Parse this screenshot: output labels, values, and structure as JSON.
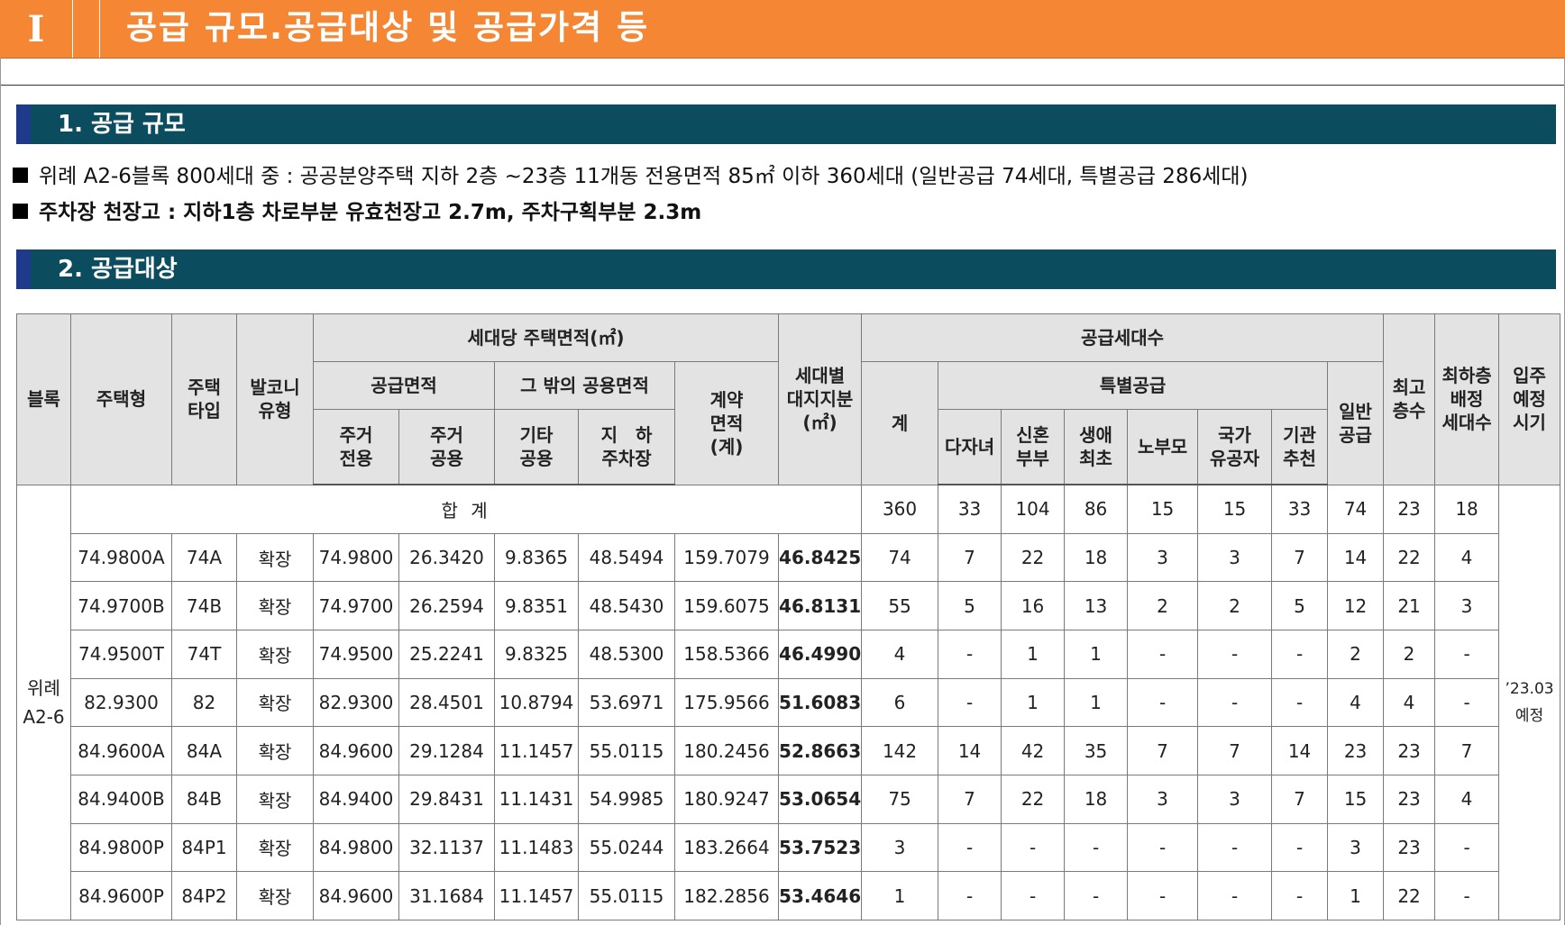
{
  "header": {
    "roman": "I",
    "title": "공급 규모.공급대상 및 공급가격 등"
  },
  "sections": {
    "s1": "1. 공급 규모",
    "s2": "2. 공급대상"
  },
  "bullets": [
    "위례 A2-6블록 800세대 중 : 공공분양주택 지하 2층 ~23층 11개동 전용면적 85㎡ 이하 360세대 (일반공급 74세대, 특별공급 286세대)",
    "주차장 천장고 : 지하1층 차로부분 유효천장고 2.7m, 주차구획부분 2.3m"
  ],
  "table": {
    "headers": {
      "block": "블록",
      "house_type": "주택형",
      "type_a": "주택",
      "type_b": "타입",
      "balcony_a": "발코니",
      "balcony_b": "유형",
      "area_per_unit": "세대당 주택면적(㎡)",
      "supply_area": "공급면적",
      "other_common": "그 밖의 공용면적",
      "res_excl_a": "주거",
      "res_excl_b": "전용",
      "res_common_a": "주거",
      "res_common_b": "공용",
      "other_a": "기타",
      "other_b": "공용",
      "parking_a": "지　하",
      "parking_b": "주차장",
      "contract_a": "계약",
      "contract_b": "면적",
      "contract_c": "(계)",
      "land_a": "세대별",
      "land_b": "대지지분",
      "land_c": "(㎡)",
      "supply_units": "공급세대수",
      "total": "계",
      "special": "특별공급",
      "multi_child": "다자녀",
      "newlywed_a": "신혼",
      "newlywed_b": "부부",
      "first_a": "생애",
      "first_b": "최초",
      "elderly": "노부모",
      "national_a": "국가",
      "national_b": "유공자",
      "agency_a": "기관",
      "agency_b": "추천",
      "general_a": "일반",
      "general_b": "공급",
      "max_a": "최고",
      "max_b": "층수",
      "lowest_a": "최하층",
      "lowest_b": "배정",
      "lowest_c": "세대수",
      "move_a": "입주",
      "move_b": "예정",
      "move_c": "시기"
    },
    "block_a": "위례",
    "block_b": "A2-6",
    "move_in_a": "’23.03",
    "move_in_b": "예정",
    "total_row": {
      "label": "합 계",
      "total": "360",
      "multi_child": "33",
      "newlywed": "104",
      "first": "86",
      "elderly": "15",
      "national": "15",
      "agency": "33",
      "general": "74",
      "max": "23",
      "lowest": "18"
    },
    "rows": [
      {
        "house_type": "74.9800A",
        "type": "74A",
        "balcony": "확장",
        "res_excl": "74.9800",
        "res_common": "26.3420",
        "other_common": "9.8365",
        "parking": "48.5494",
        "contract": "159.7079",
        "land": "46.8425",
        "total": "74",
        "multi_child": "7",
        "newlywed": "22",
        "first": "18",
        "elderly": "3",
        "national": "3",
        "agency": "7",
        "general": "14",
        "max": "22",
        "lowest": "4"
      },
      {
        "house_type": "74.9700B",
        "type": "74B",
        "balcony": "확장",
        "res_excl": "74.9700",
        "res_common": "26.2594",
        "other_common": "9.8351",
        "parking": "48.5430",
        "contract": "159.6075",
        "land": "46.8131",
        "total": "55",
        "multi_child": "5",
        "newlywed": "16",
        "first": "13",
        "elderly": "2",
        "national": "2",
        "agency": "5",
        "general": "12",
        "max": "21",
        "lowest": "3"
      },
      {
        "house_type": "74.9500T",
        "type": "74T",
        "balcony": "확장",
        "res_excl": "74.9500",
        "res_common": "25.2241",
        "other_common": "9.8325",
        "parking": "48.5300",
        "contract": "158.5366",
        "land": "46.4990",
        "total": "4",
        "multi_child": "-",
        "newlywed": "1",
        "first": "1",
        "elderly": "-",
        "national": "-",
        "agency": "-",
        "general": "2",
        "max": "2",
        "lowest": "-"
      },
      {
        "house_type": "82.9300",
        "type": "82",
        "balcony": "확장",
        "res_excl": "82.9300",
        "res_common": "28.4501",
        "other_common": "10.8794",
        "parking": "53.6971",
        "contract": "175.9566",
        "land": "51.6083",
        "total": "6",
        "multi_child": "-",
        "newlywed": "1",
        "first": "1",
        "elderly": "-",
        "national": "-",
        "agency": "-",
        "general": "4",
        "max": "4",
        "lowest": "-"
      },
      {
        "house_type": "84.9600A",
        "type": "84A",
        "balcony": "확장",
        "res_excl": "84.9600",
        "res_common": "29.1284",
        "other_common": "11.1457",
        "parking": "55.0115",
        "contract": "180.2456",
        "land": "52.8663",
        "total": "142",
        "multi_child": "14",
        "newlywed": "42",
        "first": "35",
        "elderly": "7",
        "national": "7",
        "agency": "14",
        "general": "23",
        "max": "23",
        "lowest": "7"
      },
      {
        "house_type": "84.9400B",
        "type": "84B",
        "balcony": "확장",
        "res_excl": "84.9400",
        "res_common": "29.8431",
        "other_common": "11.1431",
        "parking": "54.9985",
        "contract": "180.9247",
        "land": "53.0654",
        "total": "75",
        "multi_child": "7",
        "newlywed": "22",
        "first": "18",
        "elderly": "3",
        "national": "3",
        "agency": "7",
        "general": "15",
        "max": "23",
        "lowest": "4"
      },
      {
        "house_type": "84.9800P",
        "type": "84P1",
        "balcony": "확장",
        "res_excl": "84.9800",
        "res_common": "32.1137",
        "other_common": "11.1483",
        "parking": "55.0244",
        "contract": "183.2664",
        "land": "53.7523",
        "total": "3",
        "multi_child": "-",
        "newlywed": "-",
        "first": "-",
        "elderly": "-",
        "national": "-",
        "agency": "-",
        "general": "3",
        "max": "23",
        "lowest": "-"
      },
      {
        "house_type": "84.9600P",
        "type": "84P2",
        "balcony": "확장",
        "res_excl": "84.9600",
        "res_common": "31.1684",
        "other_common": "11.1457",
        "parking": "55.0115",
        "contract": "182.2856",
        "land": "53.4646",
        "total": "1",
        "multi_child": "-",
        "newlywed": "-",
        "first": "-",
        "elderly": "-",
        "national": "-",
        "agency": "-",
        "general": "1",
        "max": "22",
        "lowest": "-"
      }
    ]
  }
}
